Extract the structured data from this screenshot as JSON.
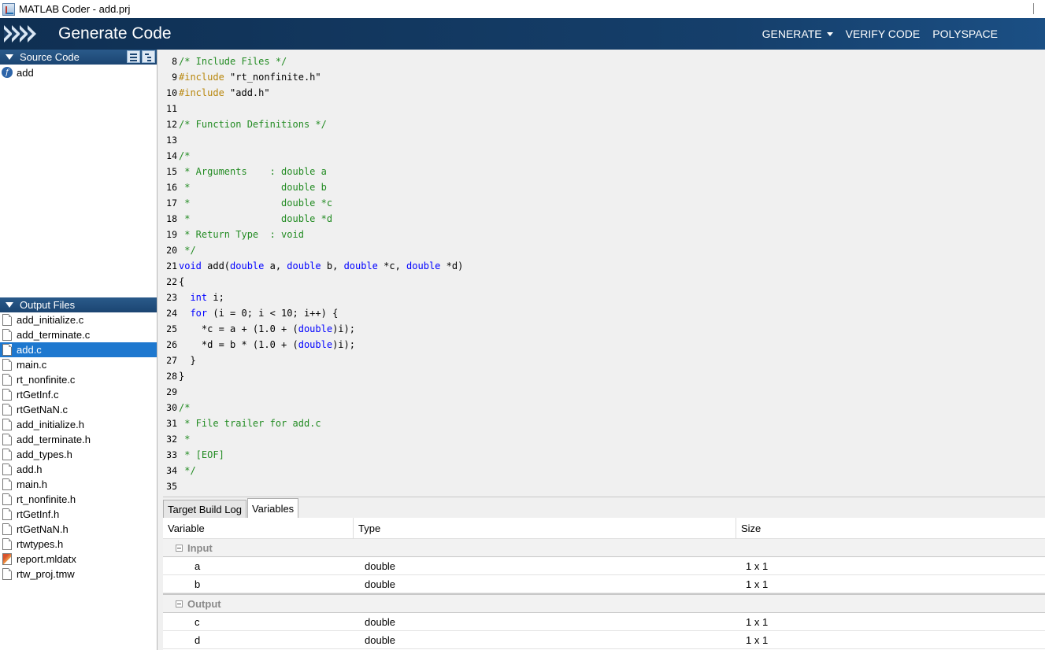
{
  "window": {
    "title": "MATLAB Coder - add.prj"
  },
  "header": {
    "title": "Generate Code",
    "actions": [
      {
        "label": "GENERATE",
        "has_menu": true
      },
      {
        "label": "VERIFY CODE"
      },
      {
        "label": "POLYSPACE"
      }
    ]
  },
  "source_code": {
    "title": "Source Code",
    "items": [
      {
        "label": "add",
        "icon": "function-icon"
      }
    ]
  },
  "output_files": {
    "title": "Output Files",
    "selected": "add.c",
    "items": [
      "add_initialize.c",
      "add_terminate.c",
      "add.c",
      "main.c",
      "rt_nonfinite.c",
      "rtGetInf.c",
      "rtGetNaN.c",
      "add_initialize.h",
      "add_terminate.h",
      "add_types.h",
      "add.h",
      "main.h",
      "rt_nonfinite.h",
      "rtGetInf.h",
      "rtGetNaN.h",
      "rtwtypes.h",
      "report.mldatx",
      "rtw_proj.tmw"
    ]
  },
  "code": {
    "lines": [
      {
        "n": "8",
        "segs": [
          {
            "t": "/* Include Files */",
            "c": "cm"
          }
        ]
      },
      {
        "n": "9",
        "segs": [
          {
            "t": "#include",
            "c": "pp"
          },
          {
            "t": " \"rt_nonfinite.h\"",
            "c": "str"
          }
        ]
      },
      {
        "n": "10",
        "segs": [
          {
            "t": "#include",
            "c": "pp"
          },
          {
            "t": " \"add.h\"",
            "c": "str"
          }
        ]
      },
      {
        "n": "11",
        "segs": []
      },
      {
        "n": "12",
        "segs": [
          {
            "t": "/* Function Definitions */",
            "c": "cm"
          }
        ]
      },
      {
        "n": "13",
        "segs": []
      },
      {
        "n": "14",
        "segs": [
          {
            "t": "/*",
            "c": "cm"
          }
        ]
      },
      {
        "n": "15",
        "segs": [
          {
            "t": " * Arguments    : double a",
            "c": "cm"
          }
        ]
      },
      {
        "n": "16",
        "segs": [
          {
            "t": " *                double b",
            "c": "cm"
          }
        ]
      },
      {
        "n": "17",
        "segs": [
          {
            "t": " *                double *c",
            "c": "cm"
          }
        ]
      },
      {
        "n": "18",
        "segs": [
          {
            "t": " *                double *d",
            "c": "cm"
          }
        ]
      },
      {
        "n": "19",
        "segs": [
          {
            "t": " * Return Type  : void",
            "c": "cm"
          }
        ]
      },
      {
        "n": "20",
        "segs": [
          {
            "t": " */",
            "c": "cm"
          }
        ]
      },
      {
        "n": "21",
        "segs": [
          {
            "t": "void",
            "c": "kw"
          },
          {
            "t": " add(",
            "c": "txt"
          },
          {
            "t": "double",
            "c": "kw"
          },
          {
            "t": " a, ",
            "c": "txt"
          },
          {
            "t": "double",
            "c": "kw"
          },
          {
            "t": " b, ",
            "c": "txt"
          },
          {
            "t": "double",
            "c": "kw"
          },
          {
            "t": " *c, ",
            "c": "txt"
          },
          {
            "t": "double",
            "c": "kw"
          },
          {
            "t": " *d)",
            "c": "txt"
          }
        ]
      },
      {
        "n": "22",
        "segs": [
          {
            "t": "{",
            "c": "txt"
          }
        ]
      },
      {
        "n": "23",
        "segs": [
          {
            "t": "  ",
            "c": "txt"
          },
          {
            "t": "int",
            "c": "kw"
          },
          {
            "t": " i;",
            "c": "txt"
          }
        ]
      },
      {
        "n": "24",
        "segs": [
          {
            "t": "  ",
            "c": "txt"
          },
          {
            "t": "for",
            "c": "kw"
          },
          {
            "t": " (i = 0; i < 10; i++) {",
            "c": "txt"
          }
        ]
      },
      {
        "n": "25",
        "segs": [
          {
            "t": "    *c = a + (1.0 + (",
            "c": "txt"
          },
          {
            "t": "double",
            "c": "kw"
          },
          {
            "t": ")i);",
            "c": "txt"
          }
        ]
      },
      {
        "n": "26",
        "segs": [
          {
            "t": "    *d = b * (1.0 + (",
            "c": "txt"
          },
          {
            "t": "double",
            "c": "kw"
          },
          {
            "t": ")i);",
            "c": "txt"
          }
        ]
      },
      {
        "n": "27",
        "segs": [
          {
            "t": "  }",
            "c": "txt"
          }
        ]
      },
      {
        "n": "28",
        "segs": [
          {
            "t": "}",
            "c": "txt"
          }
        ]
      },
      {
        "n": "29",
        "segs": []
      },
      {
        "n": "30",
        "segs": [
          {
            "t": "/*",
            "c": "cm"
          }
        ]
      },
      {
        "n": "31",
        "segs": [
          {
            "t": " * File trailer for add.c",
            "c": "cm"
          }
        ]
      },
      {
        "n": "32",
        "segs": [
          {
            "t": " *",
            "c": "cm"
          }
        ]
      },
      {
        "n": "33",
        "segs": [
          {
            "t": " * [EOF]",
            "c": "cm"
          }
        ]
      },
      {
        "n": "34",
        "segs": [
          {
            "t": " */",
            "c": "cm"
          }
        ]
      },
      {
        "n": "35",
        "segs": []
      }
    ]
  },
  "bottom": {
    "tabs": [
      {
        "label": "Target Build Log",
        "active": false
      },
      {
        "label": "Variables",
        "active": true
      }
    ],
    "columns": {
      "variable": "Variable",
      "type": "Type",
      "size": "Size"
    },
    "groups": [
      {
        "label": "Input",
        "rows": [
          {
            "name": "a",
            "type": "double",
            "size": "1 x 1"
          },
          {
            "name": "b",
            "type": "double",
            "size": "1 x 1"
          }
        ]
      },
      {
        "label": "Output",
        "rows": [
          {
            "name": "c",
            "type": "double",
            "size": "1 x 1"
          },
          {
            "name": "d",
            "type": "double",
            "size": "1 x 1"
          }
        ]
      }
    ]
  }
}
